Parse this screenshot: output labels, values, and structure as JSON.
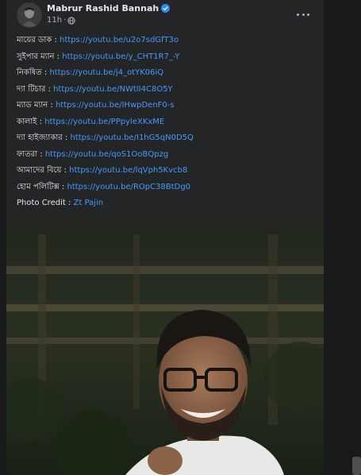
{
  "post": {
    "author": "Mabrur Rashid Bannah",
    "time": "11h",
    "time_sep": "·",
    "lines": [
      {
        "label": "মায়ের ডাক : ",
        "link": "https://youtu.be/u2o7sdGfT3o"
      },
      {
        "label": "সুইপার ম্যান : ",
        "link": "https://youtu.be/y_CHT1R7_-Y"
      },
      {
        "label": "নিকষিত : ",
        "link": "https://youtu.be/j4_otYK06iQ"
      },
      {
        "label": "দ্যা টিচার : ",
        "link": "https://youtu.be/NWtlI4C8O5Y"
      },
      {
        "label": "ম্যাড ম্যান : ",
        "link": "https://youtu.be/IHwpDenF0-s"
      },
      {
        "label": "কালাই : ",
        "link": "https://youtu.be/PPpyleXKxME"
      },
      {
        "label": "দ্যা হাইজ্যাকার : ",
        "link": "https://youtu.be/I1hG5qN0D5Q"
      },
      {
        "label": "ফাতরা : ",
        "link": "https://youtu.be/qoS1OoBQpzg"
      },
      {
        "label": "আমাদের বিয়ে : ",
        "link": "https://youtu.be/lqVph5Kvcb8"
      },
      {
        "label": "হোম পলিটিক্স : ",
        "link": "https://youtu.be/ROpC38BtDg0"
      },
      {
        "label": "Photo Credit : ",
        "link": "Zt Pajin"
      }
    ]
  },
  "icons": {
    "verified": "verified-badge-icon",
    "privacy": "globe-icon",
    "more": "more-options-icon"
  },
  "colors": {
    "background": "#18191a",
    "card": "#242526",
    "link": "#4599ff",
    "text": "#e4e6eb",
    "secondary": "#b0b3b8",
    "verified": "#2d88ff"
  }
}
